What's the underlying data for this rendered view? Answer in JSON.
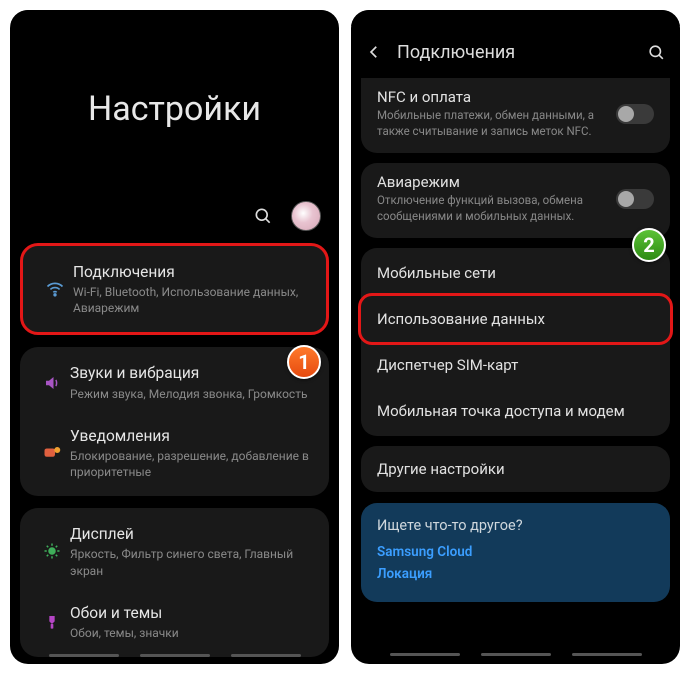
{
  "screen1": {
    "title": "Настройки",
    "step_badge": "1",
    "items": {
      "connections": {
        "title": "Подключения",
        "sub": "Wi-Fi, Bluetooth, Использование данных, Авиарежим"
      },
      "sounds": {
        "title": "Звуки и вибрация",
        "sub": "Режим звука, Мелодия звонка, Громкость"
      },
      "notifications": {
        "title": "Уведомления",
        "sub": "Блокирование, разрешение, добавление в приоритетные"
      },
      "display": {
        "title": "Дисплей",
        "sub": "Яркость, Фильтр синего света, Главный экран"
      },
      "wallpaper": {
        "title": "Обои и темы",
        "sub": "Обои, темы, значки"
      }
    }
  },
  "screen2": {
    "header_title": "Подключения",
    "step_badge": "2",
    "nfc": {
      "title": "NFC и оплата",
      "sub": "Мобильные платежи, обмен данными, а также считывание и запись меток NFC."
    },
    "airplane": {
      "title": "Авиарежим",
      "sub": "Отключение функций вызова, обмена сообщениями и мобильных данных."
    },
    "mobile_networks": "Мобильные сети",
    "data_usage": "Использование данных",
    "sim": "Диспетчер SIM-карт",
    "hotspot": "Мобильная точка доступа и модем",
    "other": "Другие настройки",
    "info": {
      "title": "Ищете что-то другое?",
      "link1": "Samsung Cloud",
      "link2": "Локация"
    }
  }
}
